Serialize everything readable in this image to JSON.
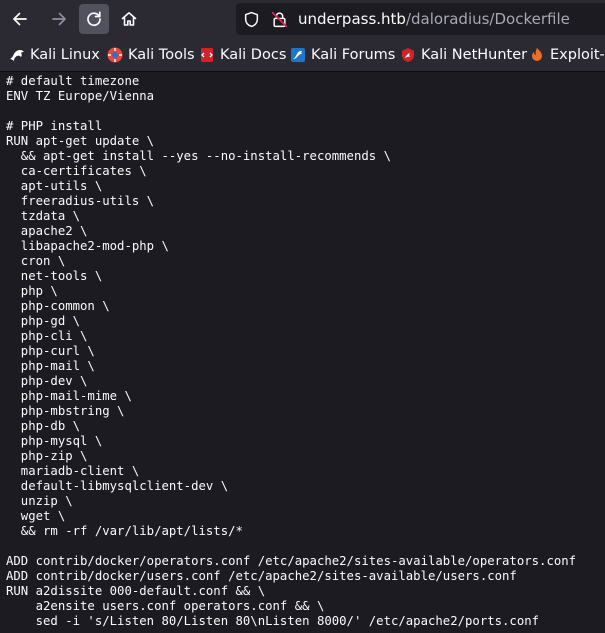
{
  "toolbar": {
    "back_icon": "arrow-left-icon",
    "forward_icon": "arrow-right-icon",
    "reload_icon": "reload-icon",
    "home_icon": "home-icon"
  },
  "urlbar": {
    "host": "underpass.htb",
    "path": "/daloradius/Dockerfile",
    "shield_icon": "shield-icon",
    "lock_icon": "insecure-lock-icon"
  },
  "bookmarks": [
    {
      "label": "Kali Linux",
      "icon": "kali-dragon-icon",
      "color": "#ffffff"
    },
    {
      "label": "Kali Tools",
      "icon": "kali-tools-icon",
      "color": "#e8483d"
    },
    {
      "label": "Kali Docs",
      "icon": "kali-docs-icon",
      "color": "#d1232a"
    },
    {
      "label": "Kali Forums",
      "icon": "kali-forums-icon",
      "color": "#1f76c8"
    },
    {
      "label": "Kali NetHunter",
      "icon": "kali-nethunter-icon",
      "color": "#d1232a"
    },
    {
      "label": "Exploit-DB",
      "icon": "exploit-db-icon",
      "color": "#ec6d24"
    }
  ],
  "file_lines": [
    "# default timezone",
    "ENV TZ Europe/Vienna",
    "",
    "# PHP install",
    "RUN apt-get update \\",
    "  && apt-get install --yes --no-install-recommends \\",
    "  ca-certificates \\",
    "  apt-utils \\",
    "  freeradius-utils \\",
    "  tzdata \\",
    "  apache2 \\",
    "  libapache2-mod-php \\",
    "  cron \\",
    "  net-tools \\",
    "  php \\",
    "  php-common \\",
    "  php-gd \\",
    "  php-cli \\",
    "  php-curl \\",
    "  php-mail \\",
    "  php-dev \\",
    "  php-mail-mime \\",
    "  php-mbstring \\",
    "  php-db \\",
    "  php-mysql \\",
    "  php-zip \\",
    "  mariadb-client \\",
    "  default-libmysqlclient-dev \\",
    "  unzip \\",
    "  wget \\",
    "  && rm -rf /var/lib/apt/lists/*",
    "",
    "ADD contrib/docker/operators.conf /etc/apache2/sites-available/operators.conf",
    "ADD contrib/docker/users.conf /etc/apache2/sites-available/users.conf",
    "RUN a2dissite 000-default.conf && \\",
    "    a2ensite users.conf operators.conf && \\",
    "    sed -i 's/Listen 80/Listen 80\\nListen 8000/' /etc/apache2/ports.conf"
  ],
  "colors": {
    "toolbar_bg": "#2b2a33",
    "page_bg": "#1c1b22",
    "text": "#fbfbfe",
    "url_path": "#a8a8b3"
  }
}
